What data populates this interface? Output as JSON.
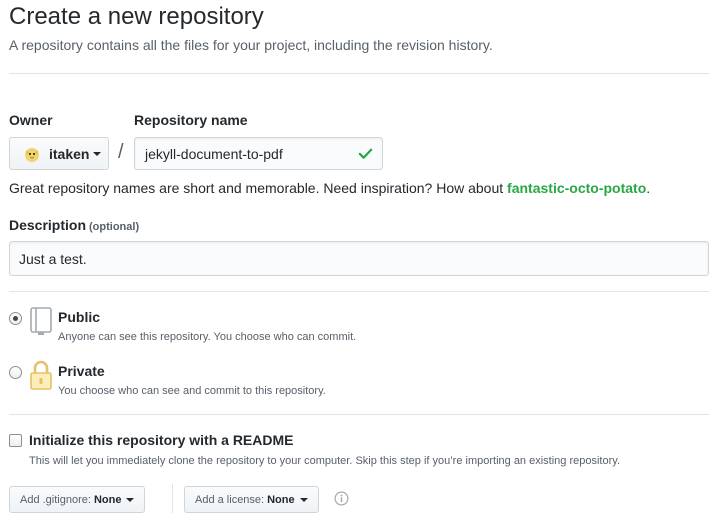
{
  "header": {
    "title": "Create a new repository",
    "subtitle": "A repository contains all the files for your project, including the revision history."
  },
  "owner": {
    "label": "Owner",
    "value": "itaken"
  },
  "separator": "/",
  "repository": {
    "label": "Repository name",
    "value": "jekyll-document-to-pdf",
    "valid": true
  },
  "hint": {
    "text": "Great repository names are short and memorable. Need inspiration? How about ",
    "suggestion": "fantastic-octo-potato",
    "end": "."
  },
  "description": {
    "label": "Description",
    "optional": "(optional)",
    "value": "Just a test."
  },
  "visibility": {
    "selected": "public",
    "public": {
      "title": "Public",
      "desc": "Anyone can see this repository. You choose who can commit."
    },
    "private": {
      "title": "Private",
      "desc": "You choose who can see and commit to this repository."
    }
  },
  "init": {
    "label": "Initialize this repository with a README",
    "desc": "This will let you immediately clone the repository to your computer. Skip this step if you’re importing an existing repository.",
    "checked": false
  },
  "gitignore": {
    "prefix": "Add .gitignore:",
    "value": "None"
  },
  "license": {
    "prefix": "Add a license:",
    "value": "None"
  },
  "colors": {
    "accent_green": "#28a745",
    "private_lock": "#e2c26b",
    "muted": "#586069"
  }
}
